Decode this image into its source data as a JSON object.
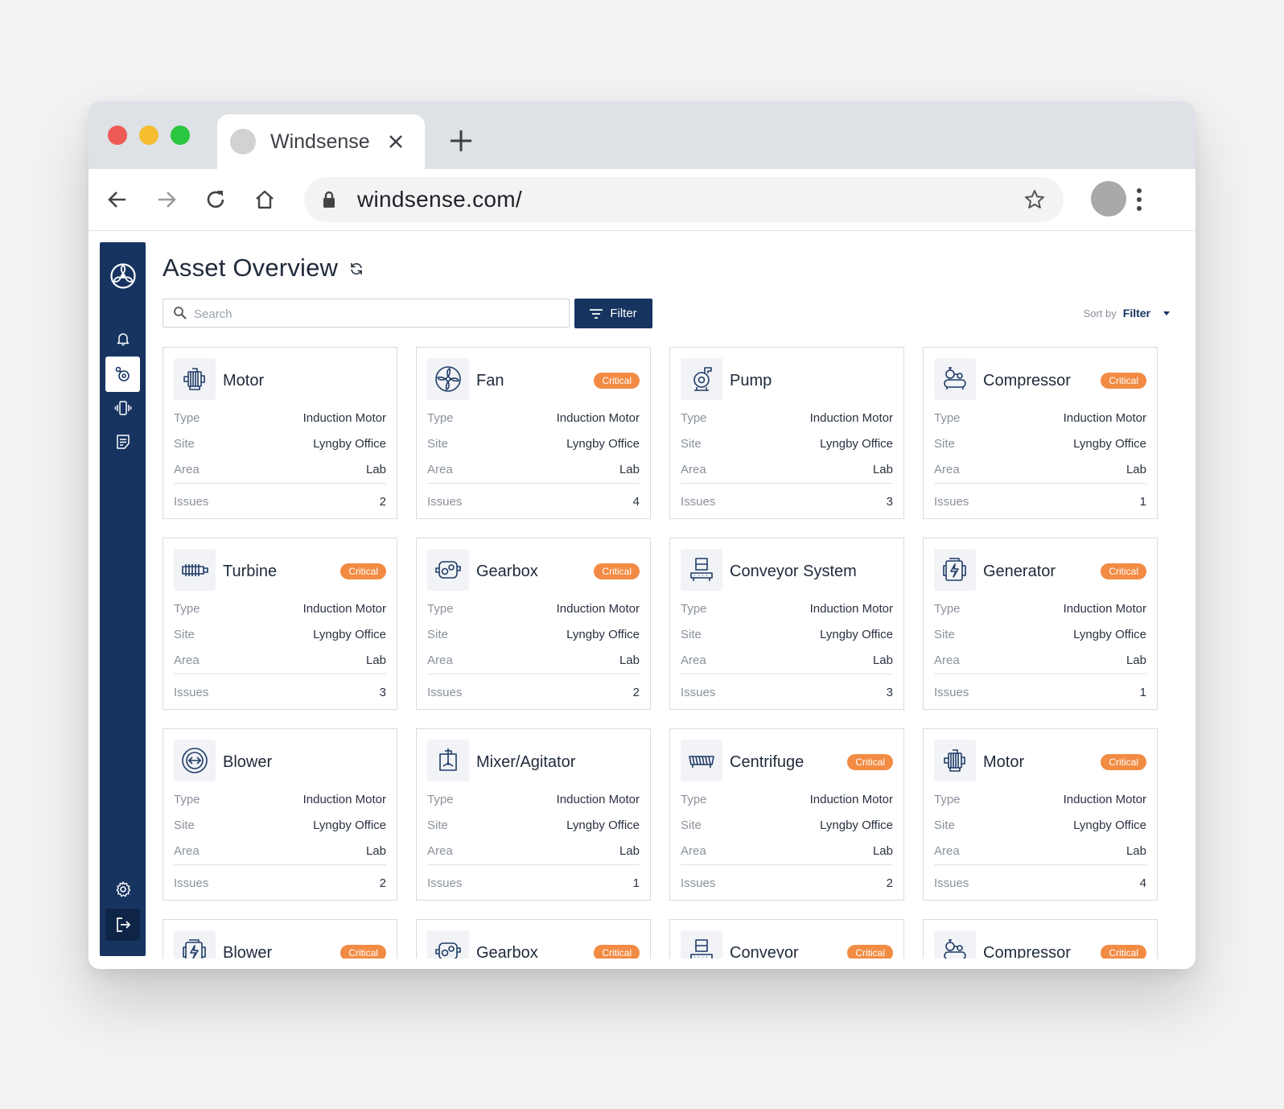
{
  "browser": {
    "tab_title": "Windsense",
    "url": "windsense.com/"
  },
  "app": {
    "page_title": "Asset Overview",
    "search": {
      "placeholder": "Search"
    },
    "filter_button": "Filter",
    "sort_by": {
      "label": "Sort by",
      "value": "Filter"
    },
    "sidebar": {
      "items": [
        {
          "icon": "bell-icon"
        },
        {
          "icon": "assets-icon",
          "active": true
        },
        {
          "icon": "vibration-icon"
        },
        {
          "icon": "reports-icon"
        }
      ],
      "bottom": [
        {
          "icon": "gear-icon"
        },
        {
          "icon": "logout-icon"
        }
      ]
    },
    "field_labels": {
      "type": "Type",
      "site": "Site",
      "area": "Area",
      "issues": "Issues"
    },
    "badge_colors": {
      "critical": "#f28b43"
    },
    "accent_color": "#173461",
    "assets": [
      {
        "name": "Motor",
        "icon": "motor-icon",
        "critical": "",
        "type": "Induction Motor",
        "site": "Lyngby Office",
        "area": "Lab",
        "issues": "2"
      },
      {
        "name": "Fan",
        "icon": "fan-icon",
        "critical": "Critical",
        "type": "Induction Motor",
        "site": "Lyngby Office",
        "area": "Lab",
        "issues": "4"
      },
      {
        "name": "Pump",
        "icon": "pump-icon",
        "critical": "",
        "type": "Induction Motor",
        "site": "Lyngby Office",
        "area": "Lab",
        "issues": "3"
      },
      {
        "name": "Compressor",
        "icon": "compressor-icon",
        "critical": "Critical",
        "type": "Induction Motor",
        "site": "Lyngby Office",
        "area": "Lab",
        "issues": "1"
      },
      {
        "name": "Turbine",
        "icon": "turbine-icon",
        "critical": "Critical",
        "type": "Induction Motor",
        "site": "Lyngby Office",
        "area": "Lab",
        "issues": "3"
      },
      {
        "name": "Gearbox",
        "icon": "gearbox-icon",
        "critical": "Critical",
        "type": "Induction Motor",
        "site": "Lyngby Office",
        "area": "Lab",
        "issues": "2"
      },
      {
        "name": "Conveyor System",
        "icon": "conveyor-icon",
        "critical": "",
        "type": "Induction Motor",
        "site": "Lyngby Office",
        "area": "Lab",
        "issues": "3"
      },
      {
        "name": "Generator",
        "icon": "generator-icon",
        "critical": "Critical",
        "type": "Induction Motor",
        "site": "Lyngby Office",
        "area": "Lab",
        "issues": "1"
      },
      {
        "name": "Blower",
        "icon": "blower-icon",
        "critical": "",
        "type": "Induction Motor",
        "site": "Lyngby Office",
        "area": "Lab",
        "issues": "2"
      },
      {
        "name": "Mixer/Agitator",
        "icon": "mixer-icon",
        "critical": "",
        "type": "Induction Motor",
        "site": "Lyngby Office",
        "area": "Lab",
        "issues": "1"
      },
      {
        "name": "Centrifuge",
        "icon": "centrifuge-icon",
        "critical": "Critical",
        "type": "Induction Motor",
        "site": "Lyngby Office",
        "area": "Lab",
        "issues": "2"
      },
      {
        "name": "Motor",
        "icon": "motor-icon",
        "critical": "Critical",
        "type": "Induction Motor",
        "site": "Lyngby Office",
        "area": "Lab",
        "issues": "4"
      },
      {
        "name": "Blower",
        "icon": "generator-icon",
        "critical": "Critical",
        "type": "",
        "site": "",
        "area": "",
        "issues": ""
      },
      {
        "name": "Gearbox",
        "icon": "gearbox-icon",
        "critical": "Critical",
        "type": "",
        "site": "",
        "area": "",
        "issues": ""
      },
      {
        "name": "Conveyor",
        "icon": "conveyor-icon",
        "critical": "Critical",
        "type": "",
        "site": "",
        "area": "",
        "issues": ""
      },
      {
        "name": "Compressor",
        "icon": "compressor-icon",
        "critical": "Critical",
        "type": "",
        "site": "",
        "area": "",
        "issues": ""
      }
    ]
  }
}
